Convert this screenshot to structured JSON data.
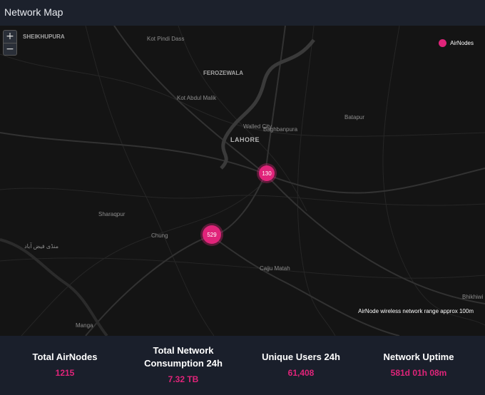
{
  "header": {
    "title": "Network Map"
  },
  "map": {
    "zoom_in_label": "+",
    "zoom_out_label": "−",
    "legend_label": "AirNodes",
    "places": {
      "sheikhupura": "SHEIKHUPURA",
      "kot_pindi_dass": "Kot Pindi Dass",
      "ferozewala": "FEROZEWALA",
      "kot_abdul_malik": "Kot Abdul Malik",
      "walled_city": "Walled City",
      "baghbanpura": "Baghbanpura",
      "batapur": "Batapur",
      "lahore": "LAHORE",
      "sharaqpur": "Sharaqpur",
      "chung": "Chung",
      "mandi_faizabad": "منڈی فیض آباد",
      "cajju_matah": "Cajju Matah",
      "bhikhiwind": "Bhikhiwi",
      "manga": "Manga"
    },
    "clusters": [
      {
        "count": "130"
      },
      {
        "count": "529"
      }
    ],
    "range_note": "AirNode wireless network range approx 100m"
  },
  "stats": [
    {
      "label": "Total AirNodes",
      "value": "1215"
    },
    {
      "label": "Total Network Consumption 24h",
      "value": "7.32 TB"
    },
    {
      "label": "Unique Users 24h",
      "value": "61,408"
    },
    {
      "label": "Network Uptime",
      "value": "581d 01h 08m"
    }
  ],
  "colors": {
    "accent": "#e0247a",
    "map_background": "#141414",
    "panel_background": "#1a1f2b"
  }
}
